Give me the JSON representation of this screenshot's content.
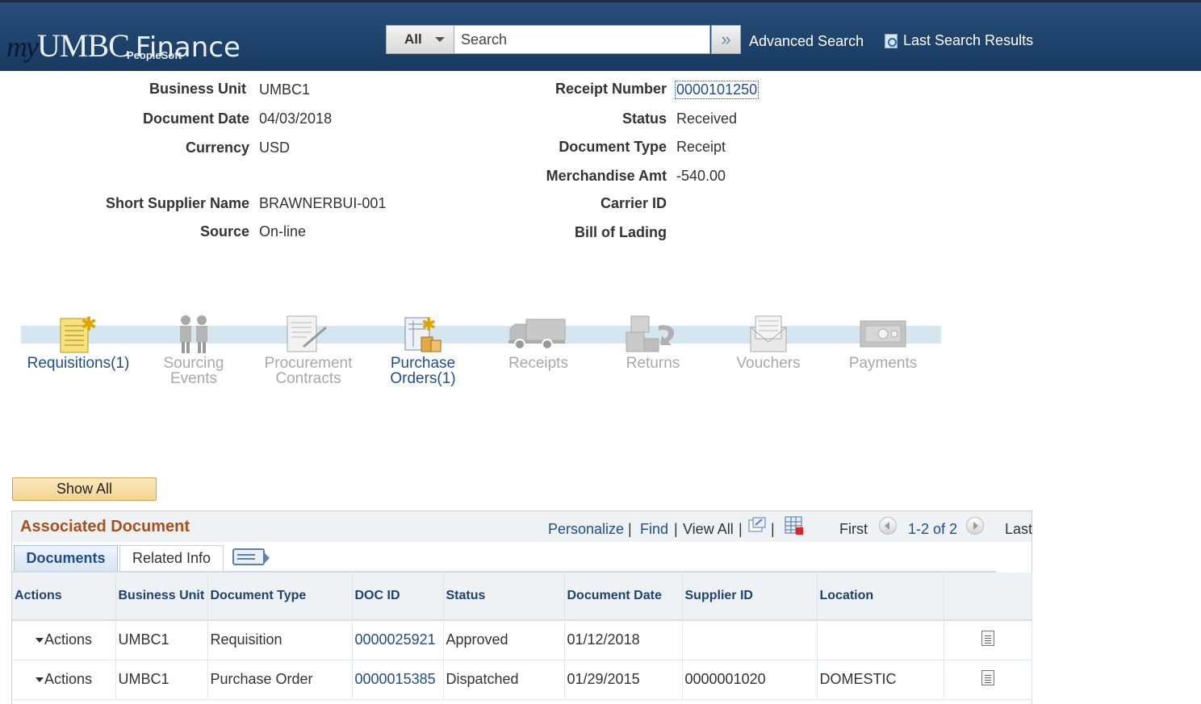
{
  "header": {
    "logo": {
      "my": "my",
      "umbc": "UMBC",
      "finance": "Finance",
      "peoplesoft": "PeopleSoft"
    },
    "search_scope": "All",
    "search_placeholder": "Search",
    "go_icon": "double-chevron-right-icon",
    "advanced_search": "Advanced Search",
    "last_search_results": "Last Search Results",
    "last_search_icon": "magnifier-document-icon"
  },
  "fields": {
    "left": [
      {
        "label": "Business Unit",
        "value": "UMBC1"
      },
      {
        "label": "Document Date",
        "value": "04/03/2018"
      },
      {
        "label": "Currency",
        "value": "USD"
      },
      {
        "label": "Short Supplier Name",
        "value": "BRAWNERBUI-001"
      },
      {
        "label": "Source",
        "value": "On-line"
      }
    ],
    "right": [
      {
        "label": "Receipt Number",
        "value": "0000101250"
      },
      {
        "label": "Status",
        "value": "Received"
      },
      {
        "label": "Document Type",
        "value": "Receipt"
      },
      {
        "label": "Merchandise Amt",
        "value": "-540.00"
      },
      {
        "label": "Carrier ID",
        "value": ""
      },
      {
        "label": "Bill of Lading",
        "value": ""
      }
    ]
  },
  "flow": [
    {
      "line1": "Requisitions(1)",
      "line2": "",
      "active": true,
      "icon": "requisition-icon"
    },
    {
      "line1": "Sourcing",
      "line2": "Events",
      "active": false,
      "icon": "sourcing-people-icon"
    },
    {
      "line1": "Procurement",
      "line2": "Contracts",
      "active": false,
      "icon": "contract-icon"
    },
    {
      "line1": "Purchase",
      "line2": "Orders(1)",
      "active": true,
      "icon": "purchase-order-icon"
    },
    {
      "line1": "Receipts",
      "line2": "",
      "active": false,
      "icon": "truck-icon"
    },
    {
      "line1": "Returns",
      "line2": "",
      "active": false,
      "icon": "returns-boxes-icon"
    },
    {
      "line1": "Vouchers",
      "line2": "",
      "active": false,
      "icon": "voucher-envelope-icon"
    },
    {
      "line1": "Payments",
      "line2": "",
      "active": false,
      "icon": "money-icon"
    }
  ],
  "show_all": "Show All",
  "grid": {
    "title": "Associated Document",
    "personalize": "Personalize",
    "find": "Find",
    "view_all": "View All",
    "first": "First",
    "range": "1-2 of 2",
    "last": "Last",
    "tabs": [
      "Documents",
      "Related Info"
    ],
    "columns": [
      "Actions",
      "Business Unit",
      "Document Type",
      "DOC ID",
      "Status",
      "Document Date",
      "Supplier ID",
      "Location",
      ""
    ],
    "rows": [
      {
        "actions": "Actions",
        "bu": "UMBC1",
        "doc_type": "Requisition",
        "doc_id": "0000025921",
        "status": "Approved",
        "date": "01/12/2018",
        "supplier": "",
        "location": ""
      },
      {
        "actions": "Actions",
        "bu": "UMBC1",
        "doc_type": "Purchase Order",
        "doc_id": "0000015385",
        "status": "Dispatched",
        "date": "01/29/2015",
        "supplier": "0000001020",
        "location": "DOMESTIC"
      }
    ]
  },
  "colors": {
    "header_blue": "#21466f",
    "link_blue": "#1f4e8c",
    "title_orange": "#a8501b",
    "flow_band": "#d4e6f0"
  }
}
